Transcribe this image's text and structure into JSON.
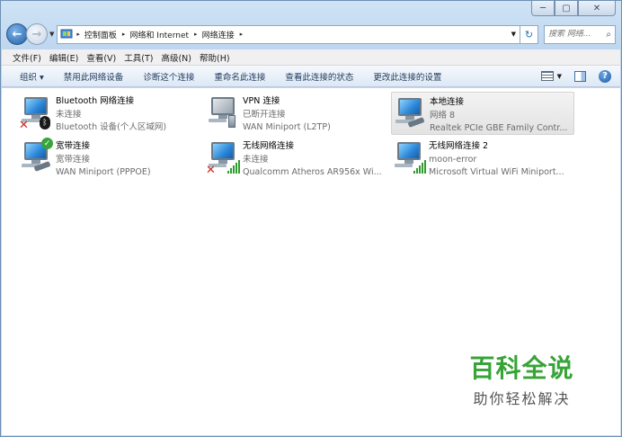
{
  "window": {
    "controls": {
      "minimize": "─",
      "maximize": "▢",
      "close": "✕"
    }
  },
  "nav": {
    "back_glyph": "←",
    "forward_glyph": "→",
    "history_glyph": "▼",
    "breadcrumbs": [
      "控制面板",
      "网络和 Internet",
      "网络连接"
    ],
    "crumb_sep": "▸",
    "address_dropdown": "▼",
    "refresh_glyph": "↻",
    "search_placeholder": "搜索 网络...",
    "search_icon": "⌕"
  },
  "menu": [
    "文件(F)",
    "编辑(E)",
    "查看(V)",
    "工具(T)",
    "高级(N)",
    "帮助(H)"
  ],
  "commands": {
    "organize": "组织 ▾",
    "items": [
      "禁用此网络设备",
      "诊断这个连接",
      "重命名此连接",
      "查看此连接的状态",
      "更改此连接的设置"
    ],
    "views_dropdown": "▼",
    "help": "?"
  },
  "connections": [
    {
      "name": "Bluetooth 网络连接",
      "status": "未连接",
      "device": "Bluetooth 设备(个人区域网)",
      "icon": "bluetooth-network-icon",
      "selected": false
    },
    {
      "name": "VPN 连接",
      "status": "已断开连接",
      "device": "WAN Miniport (L2TP)",
      "icon": "vpn-network-icon",
      "selected": false
    },
    {
      "name": "本地连接",
      "status": "网络  8",
      "device": "Realtek PCIe GBE Family Contr...",
      "icon": "lan-network-icon",
      "selected": true
    },
    {
      "name": "宽带连接",
      "status": "宽带连接",
      "device": "WAN Miniport (PPPOE)",
      "icon": "broadband-network-icon",
      "selected": false
    },
    {
      "name": "无线网络连接",
      "status": "未连接",
      "device": "Qualcomm Atheros AR956x Wi...",
      "icon": "wireless-network-icon",
      "selected": false
    },
    {
      "name": "无线网络连接 2",
      "status": "moon-error",
      "device": "Microsoft Virtual WiFi Miniport...",
      "icon": "wireless-network-2-icon",
      "selected": false
    }
  ],
  "badges": {
    "x": "✕",
    "bluetooth": "ᛒ",
    "ok": "✓"
  },
  "watermark": {
    "title": "百科全说",
    "subtitle": "助你轻松解决"
  },
  "colors": {
    "watermark_green": "#37a437",
    "selection_bg": "#e6e6e6",
    "error_red": "#d2231e"
  }
}
